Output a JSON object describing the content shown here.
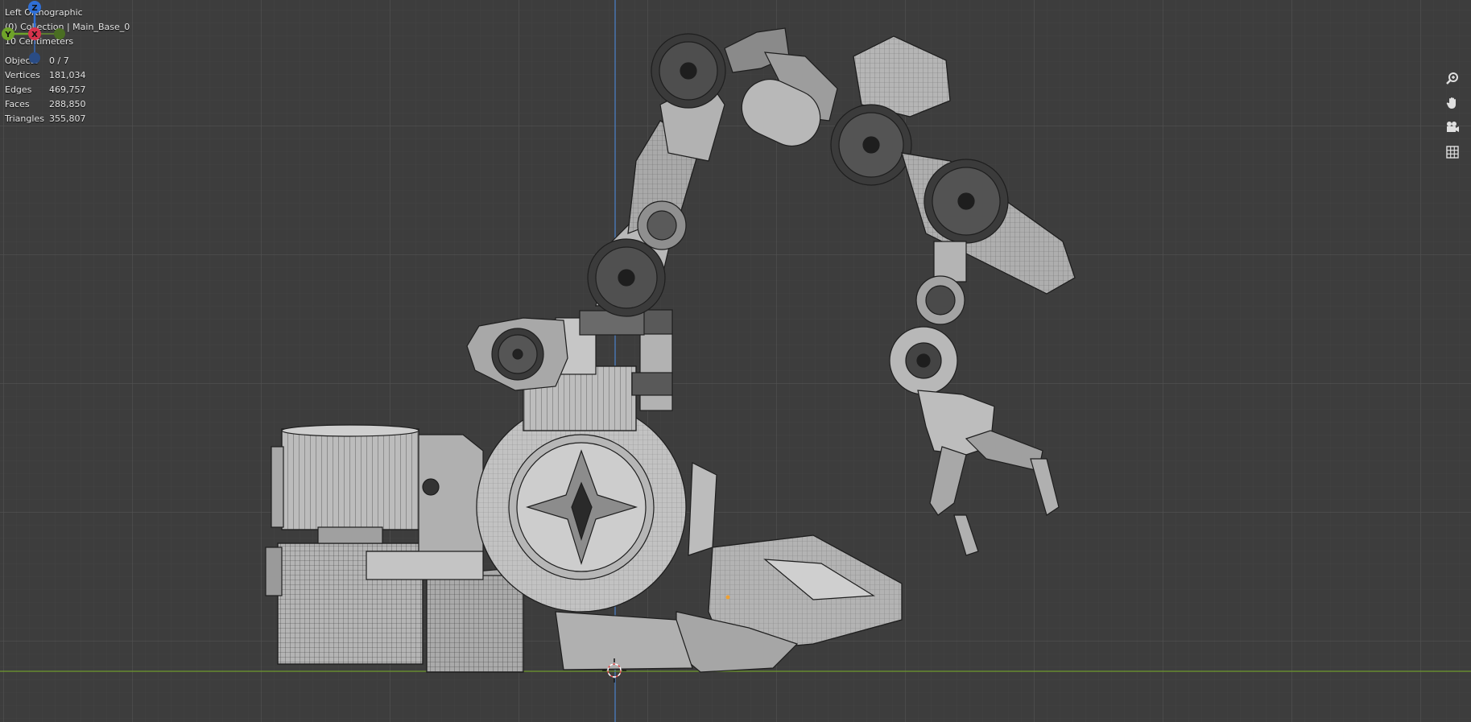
{
  "viewport": {
    "view_name": "Left Orthographic",
    "collection": "(0) Collection | Main_Base_0",
    "scale": "10 Centimeters"
  },
  "stats": [
    {
      "label": "Objects",
      "value": "0 / 7"
    },
    {
      "label": "Vertices",
      "value": "181,034"
    },
    {
      "label": "Edges",
      "value": "469,757"
    },
    {
      "label": "Faces",
      "value": "288,850"
    },
    {
      "label": "Triangles",
      "value": "355,807"
    }
  ],
  "gizmo": {
    "z_label": "Z",
    "y_label": "Y",
    "x_label": "X",
    "colors": {
      "z": "#2f6fd6",
      "y": "#6fa329",
      "x": "#d6334c"
    }
  },
  "nav_buttons": [
    {
      "name": "zoom-icon",
      "glyph": "⚲"
    },
    {
      "name": "pan-hand-icon",
      "glyph": "✋"
    },
    {
      "name": "camera-icon",
      "glyph": "🎥"
    },
    {
      "name": "grid-icon",
      "glyph": "▦"
    }
  ],
  "colors": {
    "background": "#3d3d3d",
    "grid": "#4a4a4a",
    "z_axis_line": "#4a7ec0",
    "y_axis_line": "#6f9a2e"
  }
}
